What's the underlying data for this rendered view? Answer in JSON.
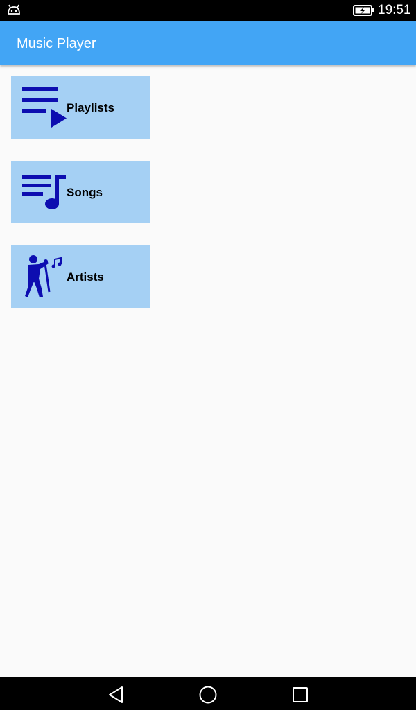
{
  "status_bar": {
    "time": "19:51",
    "left_icon": "android-icon",
    "battery_icon": "battery-charging-icon"
  },
  "app_bar": {
    "title": "Music Player",
    "color": "#42a5f5"
  },
  "menu": {
    "button_color": "#a5d0f4",
    "icon_color": "#0d0db0",
    "items": [
      {
        "label": "Playlists",
        "icon": "playlist-play-icon"
      },
      {
        "label": "Songs",
        "icon": "queue-music-icon"
      },
      {
        "label": "Artists",
        "icon": "singer-icon"
      }
    ]
  },
  "nav_bar": {
    "buttons": [
      "back-icon",
      "home-icon",
      "recents-icon"
    ]
  }
}
